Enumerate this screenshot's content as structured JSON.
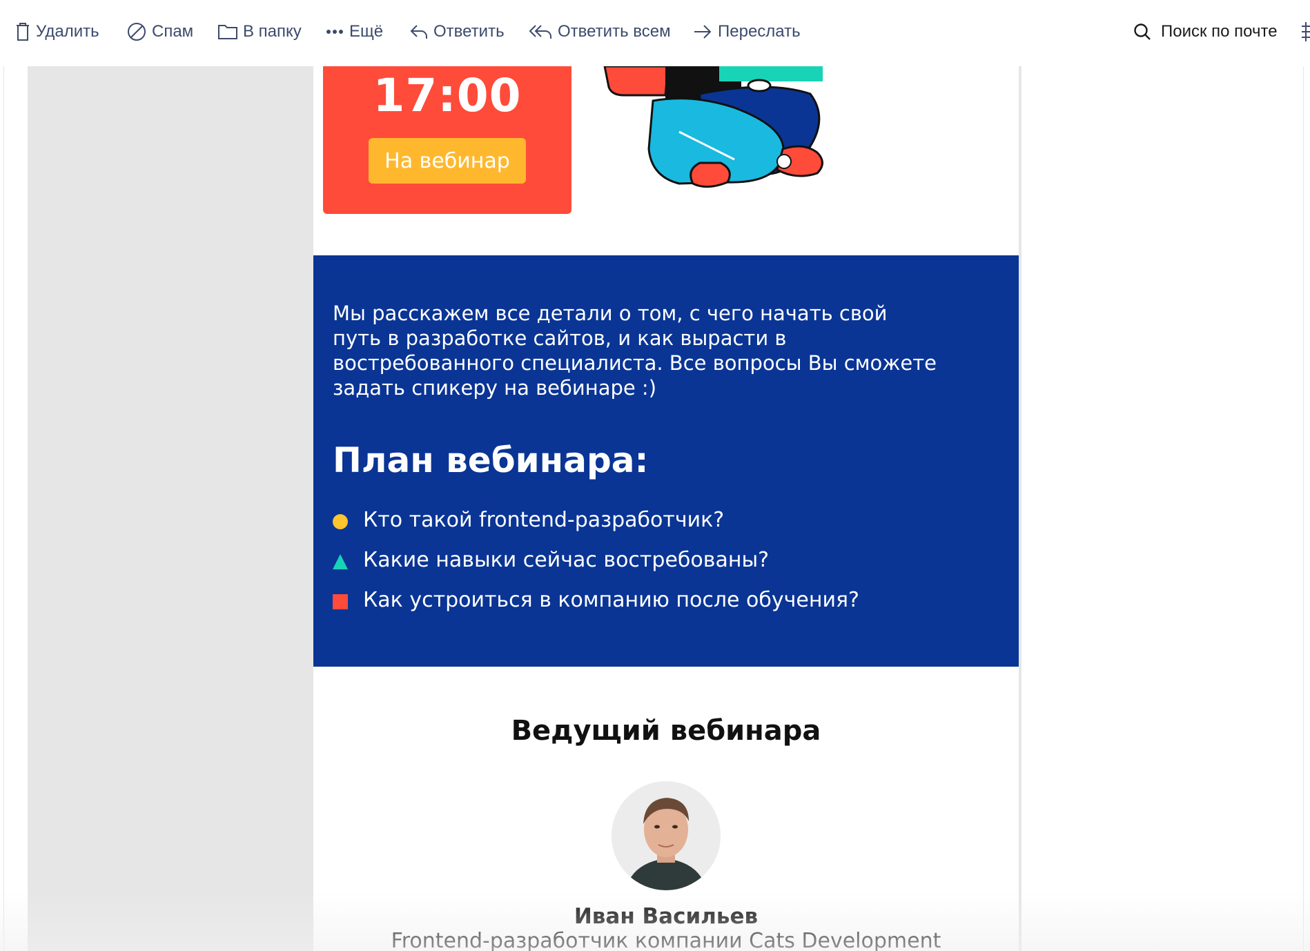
{
  "toolbar": {
    "delete_label": "Удалить",
    "spam_label": "Спам",
    "folder_label": "В папку",
    "more_label": "Ещё",
    "reply_label": "Ответить",
    "reply_all_label": "Ответить всем",
    "forward_label": "Переслать",
    "search_label": "Поиск по почте"
  },
  "email": {
    "hero": {
      "time": "17:00",
      "cta_label": "На вебинар"
    },
    "intro_text": "Мы расскажем все детали о том, с чего начать свой путь в разработке сайтов, и как вырасти в востребованного специалиста. Все вопросы Вы сможете задать спикеру на вебинаре :)",
    "plan": {
      "title": "План вебинара:",
      "items": [
        {
          "text": "Кто такой frontend-разработчик?",
          "bullet": "circle",
          "color": "#ffc42e"
        },
        {
          "text": "Какие навыки сейчас востребованы?",
          "bullet": "triangle",
          "color": "#19d3b7"
        },
        {
          "text": "Как устроиться в компанию после обучения?",
          "bullet": "square",
          "color": "#ff4b3a"
        }
      ]
    },
    "host": {
      "title": "Ведущий вебинара",
      "name": "Иван Васильев",
      "role": "Frontend-разработчик компании Cats Development"
    }
  },
  "colors": {
    "blue_section": "#0a3595",
    "red_card": "#ff4b3a",
    "cta": "#ffb82e",
    "toolbar_text": "#3c4a6b"
  }
}
